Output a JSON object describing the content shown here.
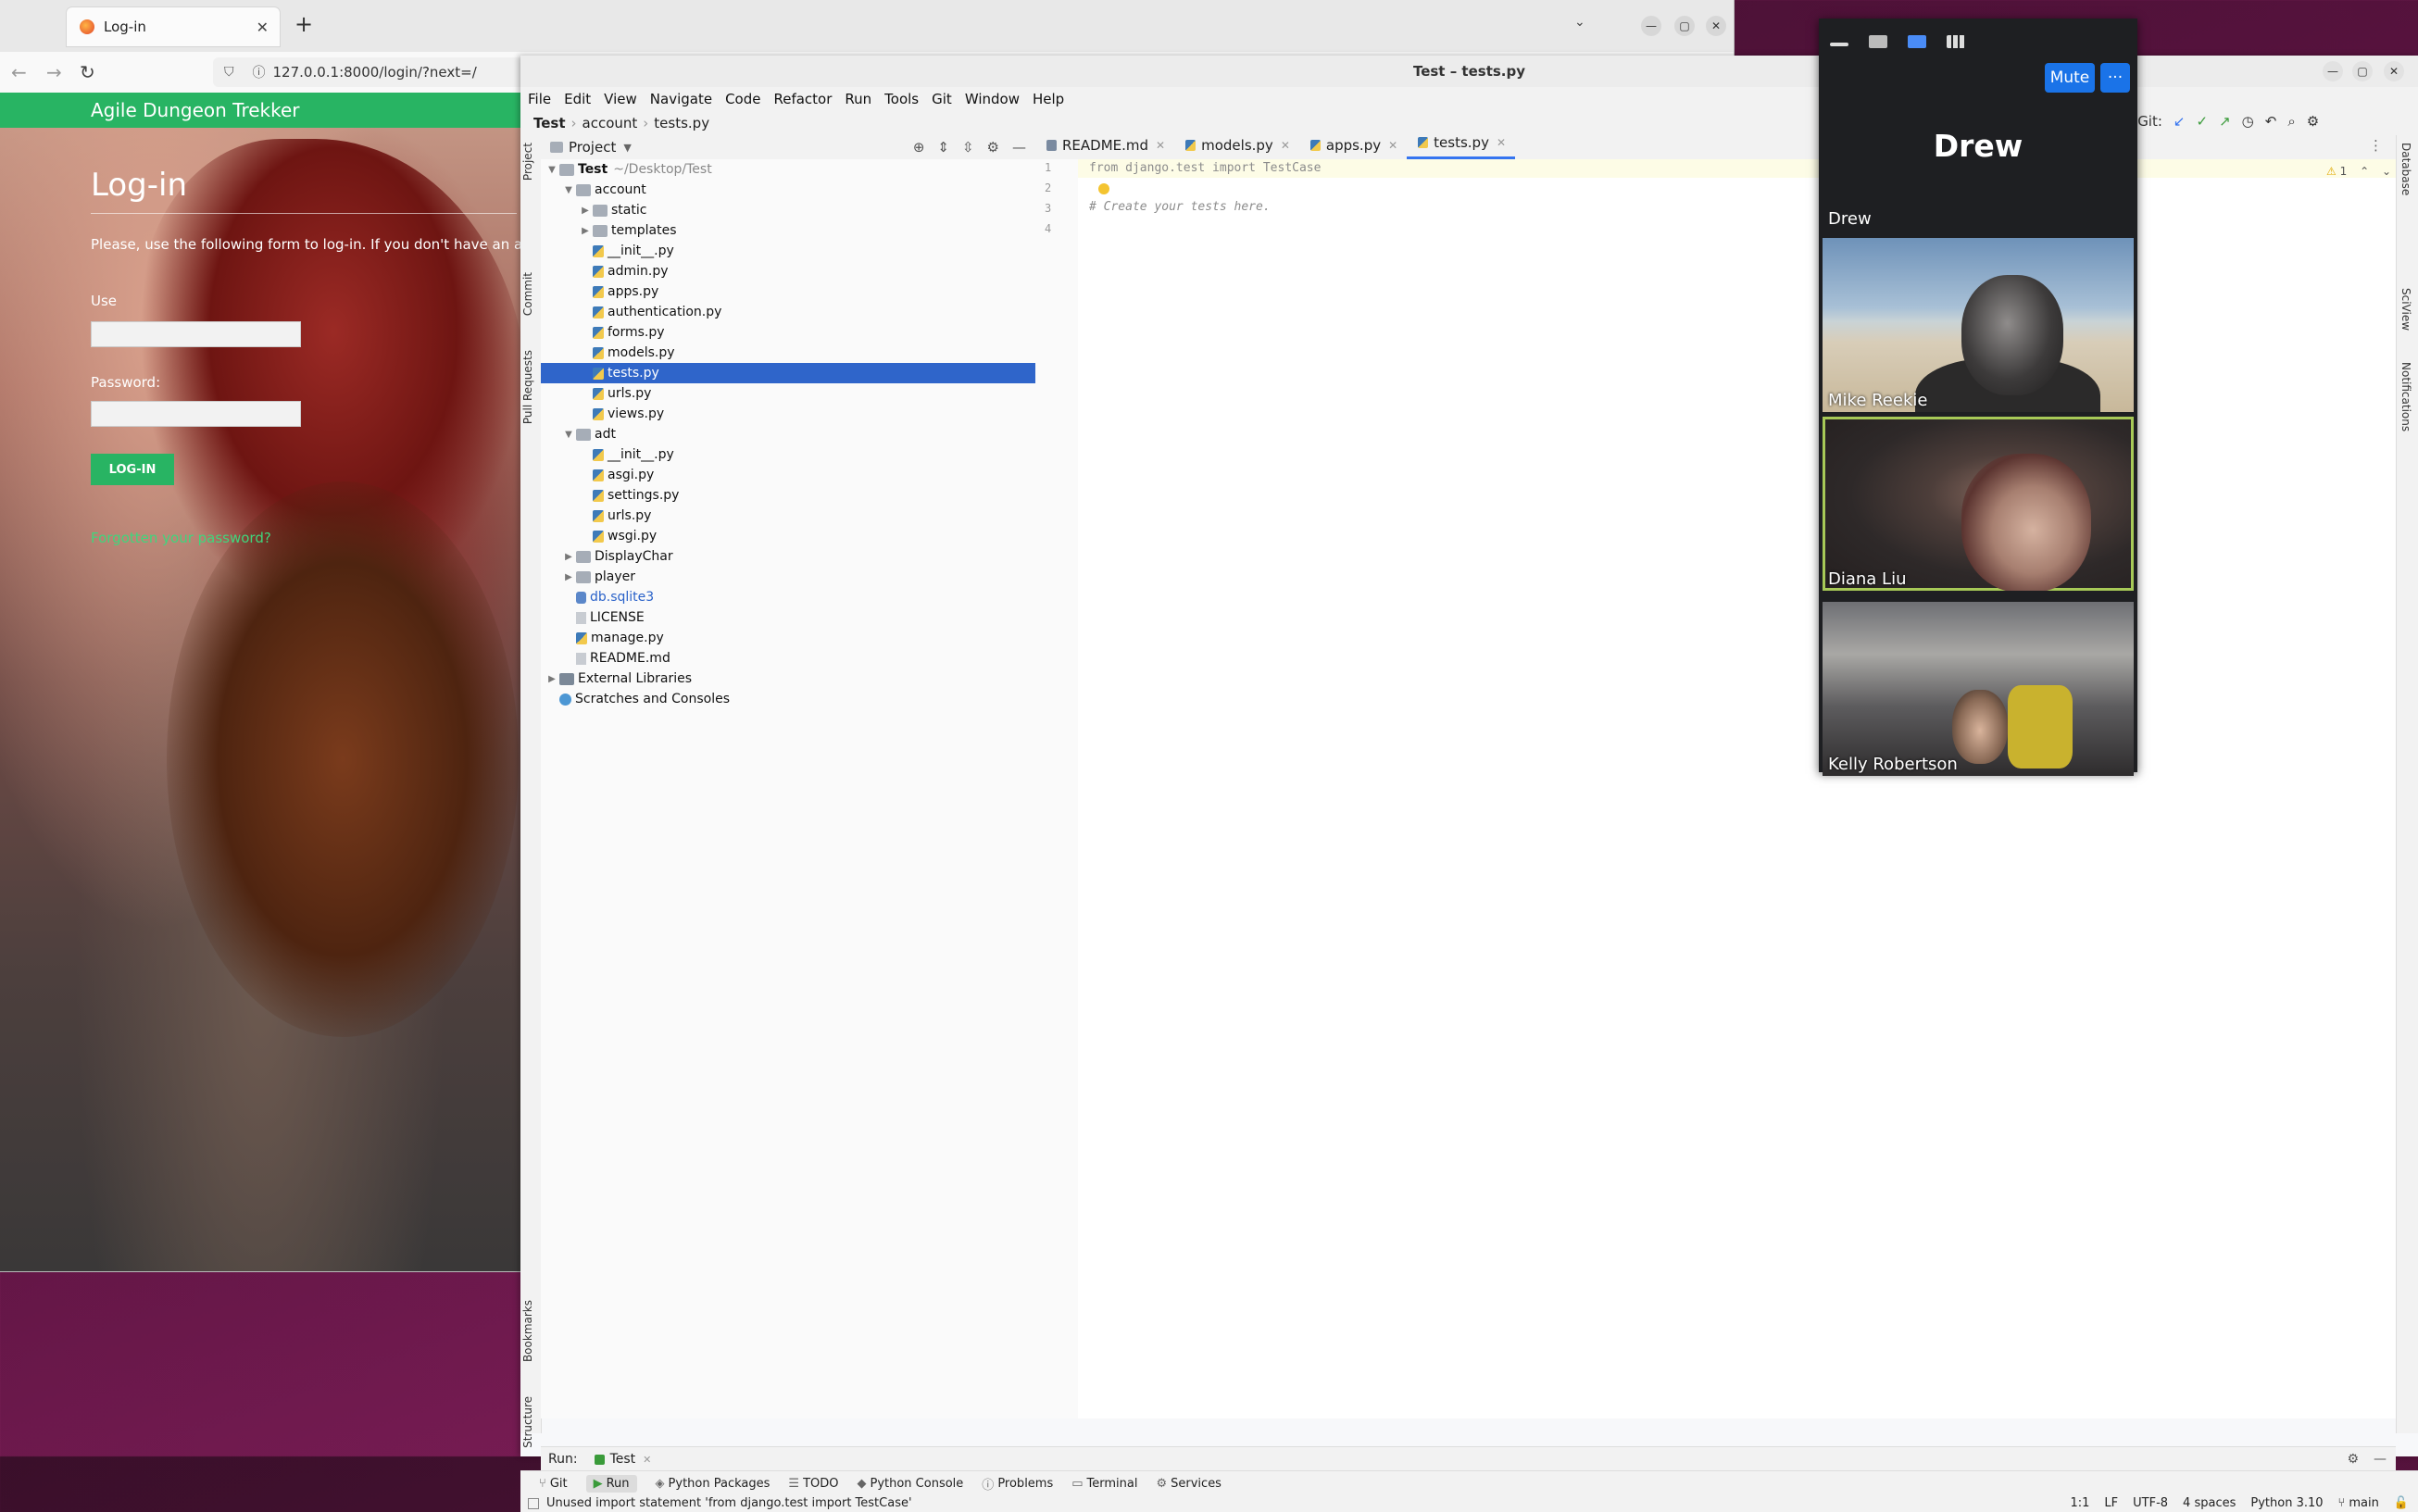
{
  "browser": {
    "tab_title": "Log-in",
    "tab_close": "✕",
    "new_tab": "+",
    "tabs_menu": "⌄",
    "url": "127.0.0.1:8000/login/?next=/",
    "window_controls": {
      "minimize": "—",
      "maximize": "▢",
      "close": "✕"
    }
  },
  "webpage": {
    "site_title": "Agile Dungeon Trekker",
    "heading": "Log-in",
    "description": "Please, use the following form to log-in. If you don't have an acco",
    "username_label": "Use",
    "password_label": "Password:",
    "login_button": "LOG-IN",
    "forgot_link": "Forgotten your password?"
  },
  "ide": {
    "window_title": "Test – tests.py",
    "menu": [
      "File",
      "Edit",
      "View",
      "Navigate",
      "Code",
      "Refactor",
      "Run",
      "Tools",
      "Git",
      "Window",
      "Help"
    ],
    "breadcrumb": {
      "project": "Test",
      "folder": "account",
      "file": "tests.py"
    },
    "git_label": "Git:",
    "left_strip": {
      "project": "Project",
      "commit": "Commit",
      "pull_requests": "Pull Requests",
      "bookmarks": "Bookmarks",
      "structure": "Structure"
    },
    "right_strip": {
      "database": "Database",
      "sciview": "SciView",
      "notifications": "Notifications"
    },
    "project_panel_title": "Project",
    "tree": [
      {
        "label": "Test",
        "extra": "~/Desktop/Test",
        "depth": 0,
        "type": "folder",
        "expanded": true,
        "bold": true
      },
      {
        "label": "account",
        "depth": 1,
        "type": "folder",
        "expanded": true
      },
      {
        "label": "static",
        "depth": 2,
        "type": "folder",
        "expanded": false
      },
      {
        "label": "templates",
        "depth": 2,
        "type": "folder",
        "expanded": false
      },
      {
        "label": "__init__.py",
        "depth": 2,
        "type": "py"
      },
      {
        "label": "admin.py",
        "depth": 2,
        "type": "py"
      },
      {
        "label": "apps.py",
        "depth": 2,
        "type": "py"
      },
      {
        "label": "authentication.py",
        "depth": 2,
        "type": "py"
      },
      {
        "label": "forms.py",
        "depth": 2,
        "type": "py"
      },
      {
        "label": "models.py",
        "depth": 2,
        "type": "py"
      },
      {
        "label": "tests.py",
        "depth": 2,
        "type": "py",
        "selected": true
      },
      {
        "label": "urls.py",
        "depth": 2,
        "type": "py"
      },
      {
        "label": "views.py",
        "depth": 2,
        "type": "py"
      },
      {
        "label": "adt",
        "depth": 1,
        "type": "folder",
        "expanded": true
      },
      {
        "label": "__init__.py",
        "depth": 2,
        "type": "py"
      },
      {
        "label": "asgi.py",
        "depth": 2,
        "type": "py"
      },
      {
        "label": "settings.py",
        "depth": 2,
        "type": "py"
      },
      {
        "label": "urls.py",
        "depth": 2,
        "type": "py"
      },
      {
        "label": "wsgi.py",
        "depth": 2,
        "type": "py"
      },
      {
        "label": "DisplayChar",
        "depth": 1,
        "type": "folder",
        "expanded": false
      },
      {
        "label": "player",
        "depth": 1,
        "type": "folder",
        "expanded": false
      },
      {
        "label": "db.sqlite3",
        "depth": 1,
        "type": "db"
      },
      {
        "label": "LICENSE",
        "depth": 1,
        "type": "txt"
      },
      {
        "label": "manage.py",
        "depth": 1,
        "type": "py"
      },
      {
        "label": "README.md",
        "depth": 1,
        "type": "md"
      },
      {
        "label": "External Libraries",
        "depth": 0,
        "type": "lib",
        "expanded": false
      },
      {
        "label": "Scratches and Consoles",
        "depth": 0,
        "type": "scratch"
      }
    ],
    "editor_tabs": [
      {
        "label": "README.md",
        "kind": "md"
      },
      {
        "label": "models.py",
        "kind": "py"
      },
      {
        "label": "apps.py",
        "kind": "py"
      },
      {
        "label": "tests.py",
        "kind": "py",
        "active": true
      }
    ],
    "code_lines": [
      "from django.test import TestCase",
      "",
      "# Create your tests here.",
      ""
    ],
    "warning_count": "1",
    "run_label": "Run:",
    "run_config": "Test",
    "tool_tabs": [
      "Git",
      "Run",
      "Python Packages",
      "TODO",
      "Python Console",
      "Problems",
      "Terminal",
      "Services"
    ],
    "status": {
      "message": "Unused import statement 'from django.test import TestCase'",
      "position": "1:1",
      "line_ending": "LF",
      "encoding": "UTF-8",
      "indent": "4 spaces",
      "interpreter": "Python 3.10",
      "branch": "main"
    }
  },
  "meeting": {
    "mute_label": "Mute",
    "more_label": "···",
    "active_speaker": "Drew",
    "speaker_label": "Drew",
    "participants": [
      "Mike Reekie",
      "Diana Liu",
      "Kelly Robertson"
    ]
  },
  "colors": {
    "site_green": "#28b463",
    "ide_selection": "#2f65ca",
    "meeting_blue": "#1a73e8",
    "active_tile_border": "#a7c957"
  }
}
